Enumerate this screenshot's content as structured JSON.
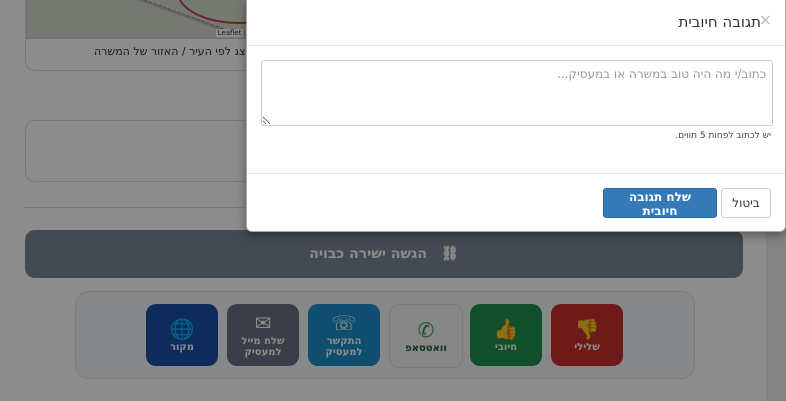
{
  "background": {
    "map_attribution": "Leaflet | © O",
    "map_caption": "מוצג לפי העיר / האזור של המשרה.",
    "submit_label": "הגשה ישירה כבויה",
    "actions": [
      {
        "label": "שלילי",
        "icon": "thumbs-down-icon",
        "color": "#c9302c"
      },
      {
        "label": "חיובי",
        "icon": "thumbs-up-icon",
        "color": "#1f8f4e"
      },
      {
        "label": "וואטסאפ",
        "icon": "whatsapp-icon",
        "color": "#f4f6f4"
      },
      {
        "label": "התקשר למעסיק",
        "icon": "phone-icon",
        "color": "#1e8fcc"
      },
      {
        "label": "שלח מייל למעסיק",
        "icon": "mail-icon",
        "color": "#6c7280"
      },
      {
        "label": "מקור",
        "icon": "globe-search-icon",
        "color": "#1a4fa8"
      }
    ]
  },
  "modal": {
    "title": "תגובה חיובית",
    "close_symbol": "×",
    "textarea_placeholder": "כתוב/י מה היה טוב במשרה או במעסיק...",
    "hint": "יש לכתוב לפחות 5 תווים.",
    "primary_button": "שלח תגובה חיובית",
    "cancel_button": "ביטול"
  }
}
